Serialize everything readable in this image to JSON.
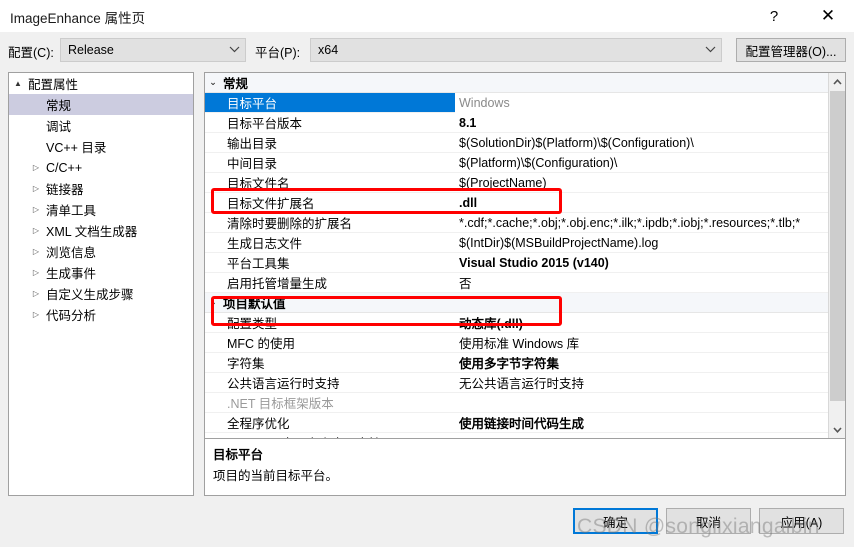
{
  "window": {
    "title": "ImageEnhance 属性页",
    "help_icon": "?",
    "close_icon": "✕"
  },
  "config_bar": {
    "config_label": "配置(C):",
    "config_value": "Release",
    "platform_label": "平台(P):",
    "platform_value": "x64",
    "config_manager_button": "配置管理器(O)..."
  },
  "tree": {
    "items": [
      {
        "label": "配置属性",
        "level": 0,
        "arrow": "▲",
        "expanded": true,
        "selected": false
      },
      {
        "label": "常规",
        "level": 1,
        "arrow": "",
        "expanded": false,
        "selected": true
      },
      {
        "label": "调试",
        "level": 1,
        "arrow": "",
        "expanded": false,
        "selected": false
      },
      {
        "label": "VC++ 目录",
        "level": 1,
        "arrow": "",
        "expanded": false,
        "selected": false
      },
      {
        "label": "C/C++",
        "level": 1,
        "arrow": "▷",
        "expanded": false,
        "selected": false
      },
      {
        "label": "链接器",
        "level": 1,
        "arrow": "▷",
        "expanded": false,
        "selected": false
      },
      {
        "label": "清单工具",
        "level": 1,
        "arrow": "▷",
        "expanded": false,
        "selected": false
      },
      {
        "label": "XML 文档生成器",
        "level": 1,
        "arrow": "▷",
        "expanded": false,
        "selected": false
      },
      {
        "label": "浏览信息",
        "level": 1,
        "arrow": "▷",
        "expanded": false,
        "selected": false
      },
      {
        "label": "生成事件",
        "level": 1,
        "arrow": "▷",
        "expanded": false,
        "selected": false
      },
      {
        "label": "自定义生成步骤",
        "level": 1,
        "arrow": "▷",
        "expanded": false,
        "selected": false
      },
      {
        "label": "代码分析",
        "level": 1,
        "arrow": "▷",
        "expanded": false,
        "selected": false
      }
    ]
  },
  "grid": {
    "rows": [
      {
        "kind": "group",
        "name": "常规",
        "chevron": "⌄"
      },
      {
        "kind": "prop",
        "name": "目标平台",
        "value": "Windows",
        "bold": false,
        "dim_value": true,
        "dim_name": false,
        "selected": true
      },
      {
        "kind": "prop",
        "name": "目标平台版本",
        "value": "8.1",
        "bold": true,
        "dim_value": false,
        "dim_name": false,
        "selected": false
      },
      {
        "kind": "prop",
        "name": "输出目录",
        "value": "$(SolutionDir)$(Platform)\\$(Configuration)\\",
        "bold": false,
        "dim_value": false,
        "dim_name": false,
        "selected": false
      },
      {
        "kind": "prop",
        "name": "中间目录",
        "value": "$(Platform)\\$(Configuration)\\",
        "bold": false,
        "dim_value": false,
        "dim_name": false,
        "selected": false
      },
      {
        "kind": "prop",
        "name": "目标文件名",
        "value": "$(ProjectName)",
        "bold": false,
        "dim_value": false,
        "dim_name": false,
        "selected": false
      },
      {
        "kind": "prop",
        "name": "目标文件扩展名",
        "value": ".dll",
        "bold": true,
        "dim_value": false,
        "dim_name": false,
        "selected": false
      },
      {
        "kind": "prop",
        "name": "清除时要删除的扩展名",
        "value": "*.cdf;*.cache;*.obj;*.obj.enc;*.ilk;*.ipdb;*.iobj;*.resources;*.tlb;*",
        "bold": false,
        "dim_value": false,
        "dim_name": false,
        "selected": false
      },
      {
        "kind": "prop",
        "name": "生成日志文件",
        "value": "$(IntDir)$(MSBuildProjectName).log",
        "bold": false,
        "dim_value": false,
        "dim_name": false,
        "selected": false
      },
      {
        "kind": "prop",
        "name": "平台工具集",
        "value": "Visual Studio 2015 (v140)",
        "bold": true,
        "dim_value": false,
        "dim_name": false,
        "selected": false
      },
      {
        "kind": "prop",
        "name": "启用托管增量生成",
        "value": "否",
        "bold": false,
        "dim_value": false,
        "dim_name": false,
        "selected": false
      },
      {
        "kind": "group",
        "name": "项目默认值",
        "chevron": "⌄"
      },
      {
        "kind": "prop",
        "name": "配置类型",
        "value": "动态库(.dll)",
        "bold": true,
        "dim_value": false,
        "dim_name": false,
        "selected": false
      },
      {
        "kind": "prop",
        "name": "MFC 的使用",
        "value": "使用标准 Windows 库",
        "bold": false,
        "dim_value": false,
        "dim_name": false,
        "selected": false
      },
      {
        "kind": "prop",
        "name": "字符集",
        "value": "使用多字节字符集",
        "bold": true,
        "dim_value": false,
        "dim_name": false,
        "selected": false
      },
      {
        "kind": "prop",
        "name": "公共语言运行时支持",
        "value": "无公共语言运行时支持",
        "bold": false,
        "dim_value": false,
        "dim_name": false,
        "selected": false
      },
      {
        "kind": "prop",
        "name": ".NET 目标框架版本",
        "value": "",
        "bold": false,
        "dim_value": false,
        "dim_name": true,
        "selected": false
      },
      {
        "kind": "prop",
        "name": "全程序优化",
        "value": "使用链接时间代码生成",
        "bold": true,
        "dim_value": false,
        "dim_name": false,
        "selected": false
      },
      {
        "kind": "prop",
        "name": "Windows 应用商店应用支持",
        "value": "否",
        "bold": false,
        "dim_value": false,
        "dim_name": false,
        "selected": false
      }
    ],
    "scrollbar": {
      "up_arrow": "▲",
      "down_arrow": "▼"
    }
  },
  "description": {
    "title": "目标平台",
    "body": "项目的当前目标平台。"
  },
  "buttons": {
    "ok": "确定",
    "cancel": "取消",
    "apply": "应用(A)"
  },
  "watermark": {
    "text": "CSDN @songlixiangaibin"
  },
  "colors": {
    "selection_blue": "#0078D7",
    "tree_selection": "#CCCCE0",
    "annotation_red": "#FF0000",
    "dialog_bg": "#F0F0F0"
  }
}
